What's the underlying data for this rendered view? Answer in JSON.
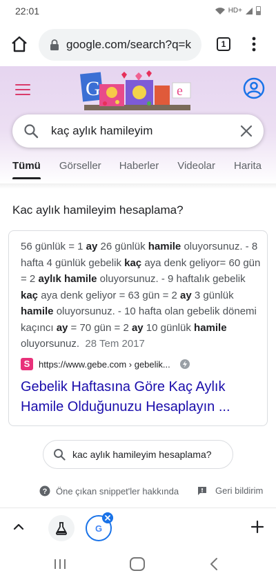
{
  "status_bar": {
    "time": "22:01",
    "network": "HD+"
  },
  "browser": {
    "url": "google.com/search?q=k",
    "tab_count": "1"
  },
  "google": {
    "search_query": "kaç aylık hamileyim",
    "tabs": [
      {
        "label": "Tümü",
        "active": true
      },
      {
        "label": "Görseller",
        "active": false
      },
      {
        "label": "Haberler",
        "active": false
      },
      {
        "label": "Videolar",
        "active": false
      },
      {
        "label": "Harita",
        "active": false
      }
    ]
  },
  "snippet": {
    "heading": "Kac aylık hamileyim hesaplama?",
    "date": "28 Tem 2017",
    "source_url": "https://www.gebe.com › gebelik...",
    "favicon_letter": "S",
    "title": "Gebelik Haftasına Göre Kaç Aylık Hamile Olduğunuzu Hesaplayın ..."
  },
  "related_search": {
    "label": "kac aylık hamileyim hesaplama?"
  },
  "footer": {
    "about_label": "Öne çıkan snippet'ler hakkında",
    "feedback_label": "Geri bildirim"
  },
  "bottom_bar": {
    "tab2_letter": "G"
  },
  "colors": {
    "header_bg": "#e6d5f0",
    "accent_pink": "#d93b6b",
    "link_blue": "#1a0dab",
    "google_blue": "#1a73e8"
  }
}
